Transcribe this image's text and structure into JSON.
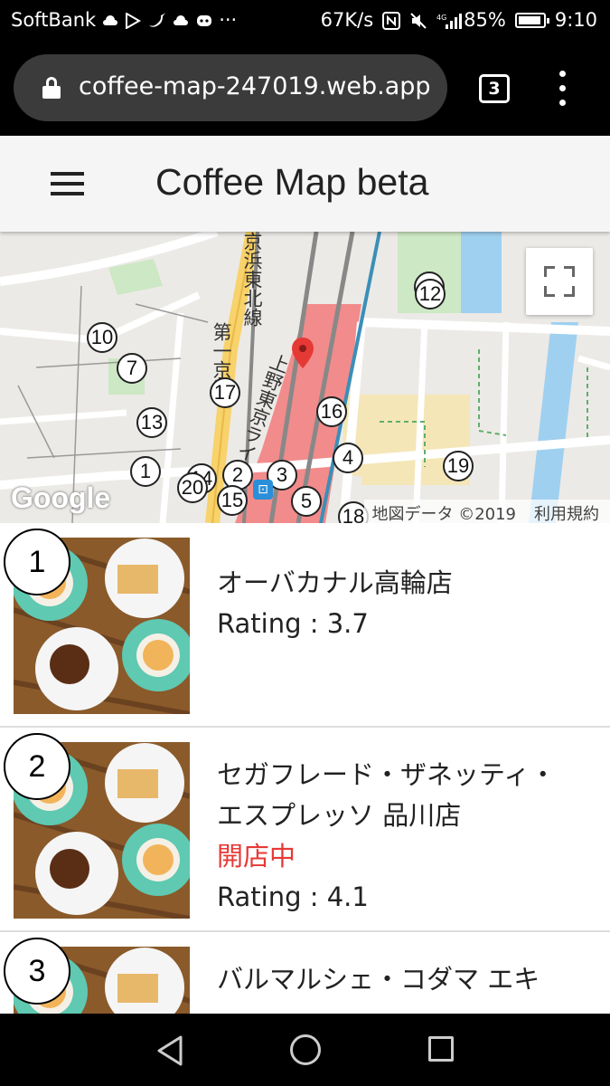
{
  "status_bar": {
    "carrier": "SoftBank",
    "network_speed": "67K/s",
    "battery": "85%",
    "time": "9:10"
  },
  "browser": {
    "url": "coffee-map-247019.web.app",
    "tab_count": "3"
  },
  "app": {
    "title": "Coffee Map beta"
  },
  "map": {
    "attribution": "地図データ ©2019",
    "terms": "利用規約",
    "google_logo": "Google",
    "road_labels": [
      "京浜東北線",
      "上野東京ライン",
      "第一京浜"
    ],
    "markers": [
      "12",
      "10",
      "7",
      "17",
      "16",
      "13",
      "4",
      "19",
      "1",
      "14",
      "2",
      "3",
      "20",
      "15",
      "5",
      "18"
    ]
  },
  "shops": [
    {
      "number": "1",
      "name": "オーバカナル高輪店",
      "status": "",
      "rating": "Rating : 3.7"
    },
    {
      "number": "2",
      "name": "セガフレード・ザネッティ・エスプレッソ 品川店",
      "status": "開店中",
      "rating": "Rating : 4.1"
    },
    {
      "number": "3",
      "name": "バルマルシェ・コダマ エキ",
      "status": "",
      "rating": ""
    }
  ],
  "colors": {
    "status_open": "#e53935",
    "appbar_bg": "#f5f5f5",
    "url_bar_bg": "#3b3b3b"
  }
}
